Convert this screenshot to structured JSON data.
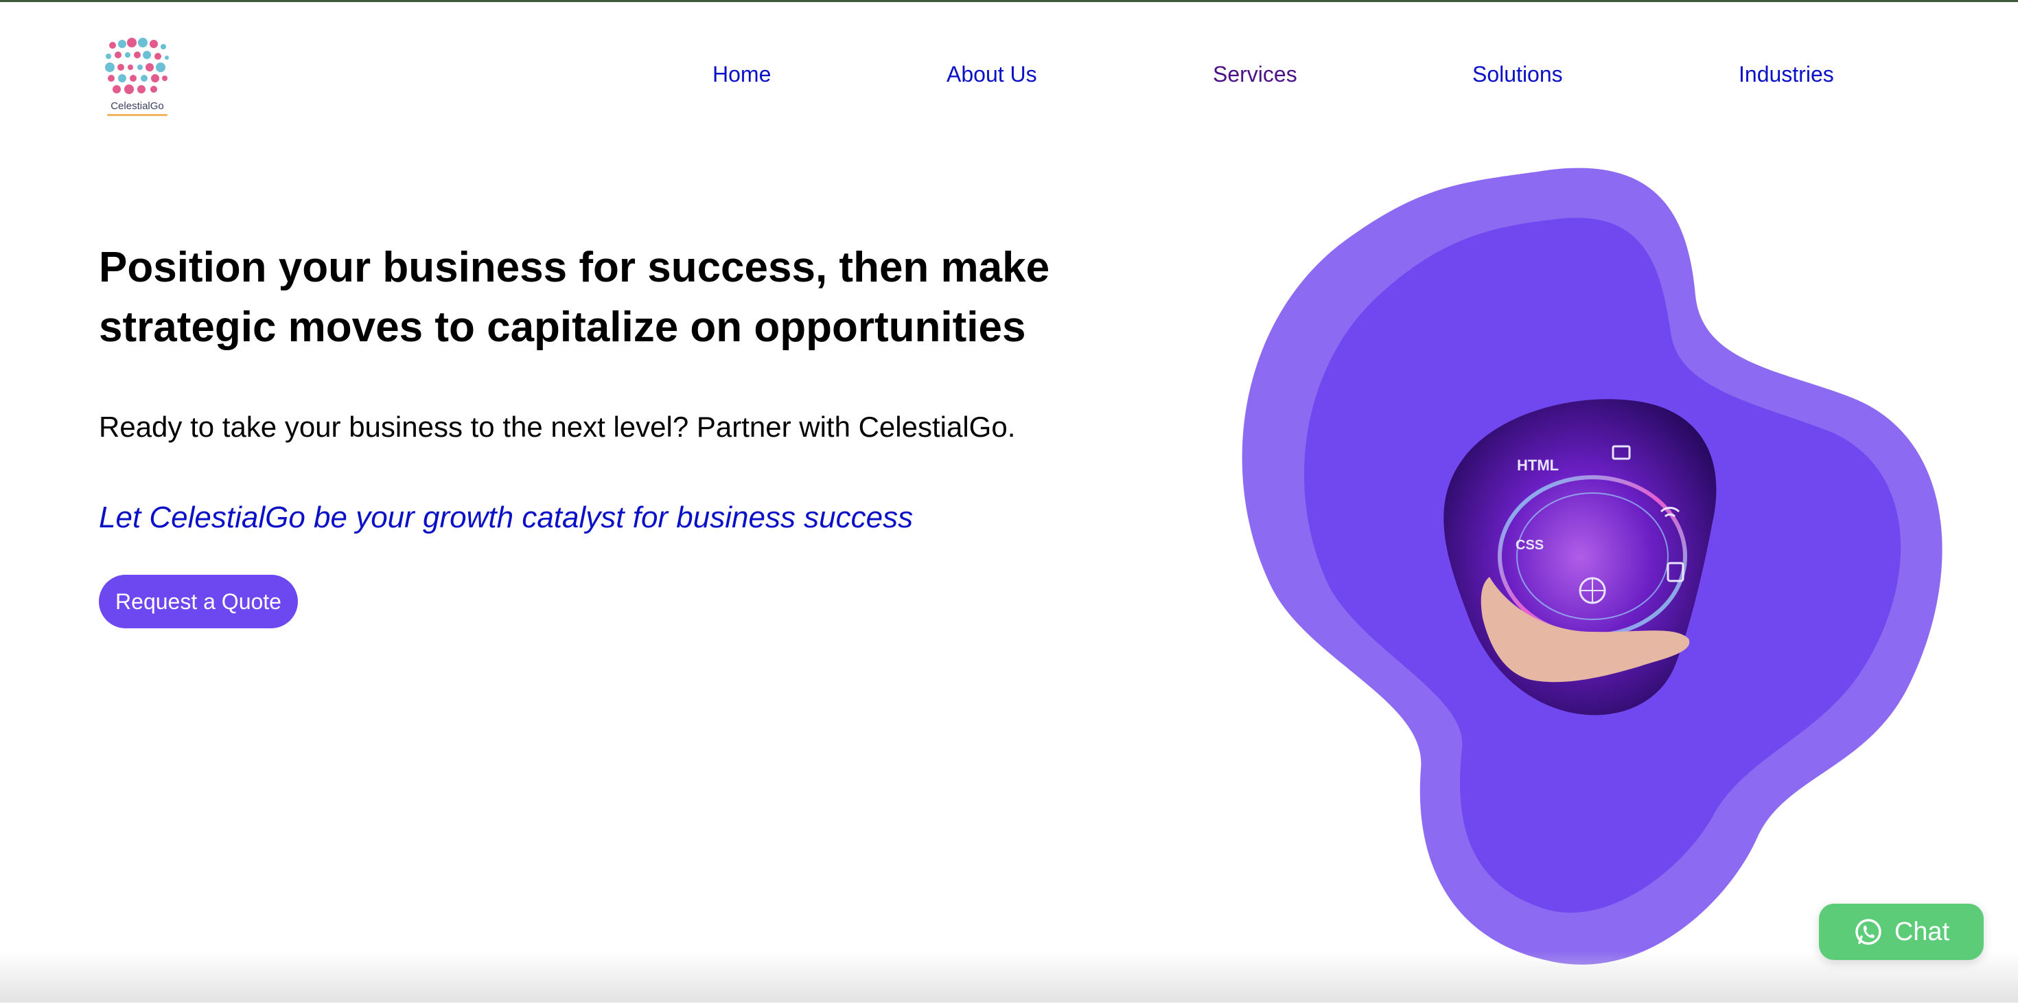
{
  "brand": {
    "name": "CelestialGo",
    "accent_color": "#6d47ef",
    "link_color": "#0a10c6",
    "active_link_color": "#4b1187"
  },
  "nav": {
    "items": [
      {
        "label": "Home",
        "active": false
      },
      {
        "label": "About Us",
        "active": false
      },
      {
        "label": "Services",
        "active": true
      },
      {
        "label": "Solutions",
        "active": false
      },
      {
        "label": "Industries",
        "active": false
      }
    ]
  },
  "hero": {
    "title_line1": "Position your business for success, then make",
    "title_line2": "strategic moves to capitalize on opportunities",
    "subtitle": "Ready to take your business to the next level? Partner with CelestialGo.",
    "tagline": "Let CelestialGo be your growth catalyst for business success",
    "cta_label": "Request a Quote",
    "image_labels": {
      "html": "HTML",
      "css": "CSS"
    }
  },
  "chat": {
    "label": "Chat",
    "icon": "whatsapp-icon",
    "color": "#5ccc79"
  }
}
